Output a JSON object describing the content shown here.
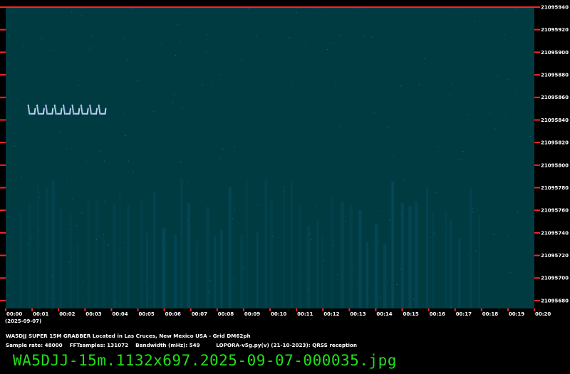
{
  "chart_data": {
    "type": "heatmap",
    "title": "",
    "xlabel": "",
    "ylabel": "",
    "x_ticks": [
      "00:00",
      "00:01",
      "00:02",
      "00:03",
      "00:04",
      "00:05",
      "00:06",
      "00:07",
      "00:08",
      "00:09",
      "00:10",
      "00:11",
      "00:12",
      "00:13",
      "00:14",
      "00:15",
      "00:16",
      "00:17",
      "00:18",
      "00:19",
      "00:20"
    ],
    "x_range_minutes": [
      0,
      20
    ],
    "date_label": "(2025-09-07)",
    "y_ticks": [
      21095940,
      21095920,
      21095900,
      21095880,
      21095860,
      21095840,
      21095820,
      21095800,
      21095780,
      21095760,
      21095740,
      21095720,
      21095700,
      21095680
    ],
    "y_range": [
      21095673,
      21095940
    ],
    "signals": [
      {
        "name": "",
        "minute_start": 0.85,
        "minute_end": 3.85,
        "freq_hz": 21095848
      }
    ],
    "colors": {
      "background": "#003b42",
      "noise": "#0a5a7a",
      "signal": "#cfe6ff",
      "marker": "#ff2222"
    }
  },
  "footer": {
    "line1": "WA5DJJ SUPER 15M GRABBER Located in Las Cruces, New Mexico USA - Grid DM62ph",
    "line2": "Sample rate: 48000    FFTsamples: 131072    Bandwidth (mHz): 549         LOPORA-v5g.py(v) (21-10-2023): QRSS reception"
  },
  "filename": "WA5DJJ-15m.1132x697.2025-09-07-000035.jpg"
}
